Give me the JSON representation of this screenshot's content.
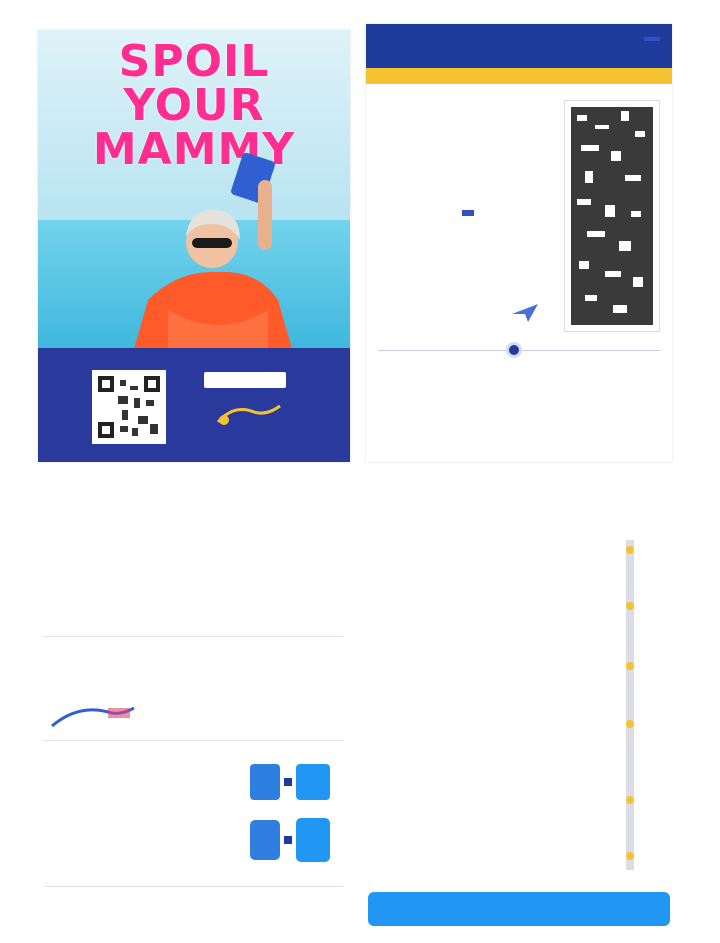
{
  "advert": {
    "headline": "SPOIL YOUR MAMMY",
    "badge": "",
    "footer": "",
    "colors": {
      "headline": "#ff2d8f",
      "band": "#2a3a9c"
    }
  },
  "boarding_pass": {
    "header_left": "",
    "header_right": "",
    "stripe_text": "",
    "passenger": "",
    "subline": "",
    "fields": [],
    "seat": "",
    "from_city": "",
    "to_city": "",
    "colors": {
      "brand": "#1f3b9b",
      "stripe": "#f4c430"
    }
  },
  "info": {
    "title": "",
    "subtitle": "",
    "body": "",
    "link": "",
    "price": "",
    "footer": ""
  },
  "timeline": {
    "heading": "",
    "items": [],
    "footer_left": "",
    "footer_right": "",
    "colors": {
      "accent": "#2196f3",
      "marker": "#f4c430"
    }
  }
}
